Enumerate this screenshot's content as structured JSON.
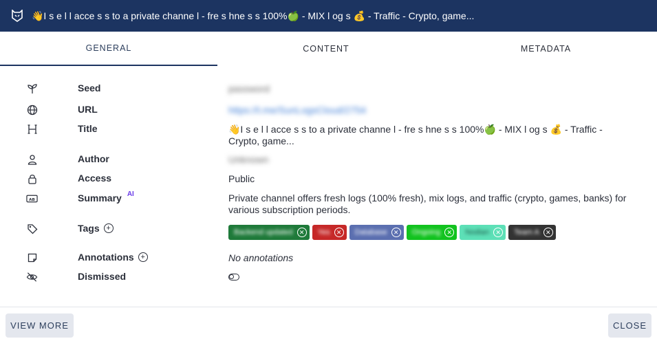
{
  "window": {
    "title": "👋I s e l l acce s s to a private channe l - fre s hne s s 100%🍏 - MIX l og s 💰 - Traffic - Crypto, game..."
  },
  "tabs": [
    {
      "label": "GENERAL",
      "active": true
    },
    {
      "label": "CONTENT",
      "active": false
    },
    {
      "label": "METADATA",
      "active": false
    }
  ],
  "fields": {
    "seed": {
      "label": "Seed",
      "value": "password",
      "icon": "sprout-icon"
    },
    "url": {
      "label": "URL",
      "value": "https://t.me/SunLogsCloud/2754",
      "icon": "globe-icon"
    },
    "title": {
      "label": "Title",
      "value": "👋I s e l l acce s s to a private channe l - fre s hne s s 100%🍏 - MIX l og s 💰 - Traffic - Crypto, game...",
      "icon": "heading-icon"
    },
    "author": {
      "label": "Author",
      "value": "Unknown",
      "icon": "user-icon"
    },
    "access": {
      "label": "Access",
      "value": "Public",
      "icon": "lock-icon"
    },
    "summary": {
      "label": "Summary",
      "badge": "AI",
      "value": "Private channel offers fresh logs (100% fresh), mix logs, and traffic (crypto, games, banks) for various subscription periods.",
      "icon": "summary-icon"
    },
    "tags": {
      "label": "Tags",
      "icon": "tag-icon"
    },
    "annotations": {
      "label": "Annotations",
      "value": "No annotations",
      "icon": "note-icon"
    },
    "dismissed": {
      "label": "Dismissed",
      "icon": "eye-off-icon"
    }
  },
  "tag_list": [
    {
      "label": "Backend updated",
      "color": "#1f7a3a",
      "text_color": "#ffffff"
    },
    {
      "label": "Yes",
      "color": "#c62828",
      "text_color": "#ffffff"
    },
    {
      "label": "Database",
      "color": "#5b6fb0",
      "text_color": "#ffffff"
    },
    {
      "label": "Ongoing",
      "color": "#12c31f",
      "text_color": "#ffffff"
    },
    {
      "label": "Nodian",
      "color": "#5de0b7",
      "text_color": "#1e5a4a"
    },
    {
      "label": "Team A",
      "color": "#333333",
      "text_color": "#ffffff"
    }
  ],
  "footer": {
    "view_more": "VIEW MORE",
    "close": "CLOSE"
  },
  "colors": {
    "header_bg": "#1c3461",
    "accent": "#2c3e5c",
    "link": "#3b7bd6",
    "ai_badge": "#6a3de8"
  }
}
